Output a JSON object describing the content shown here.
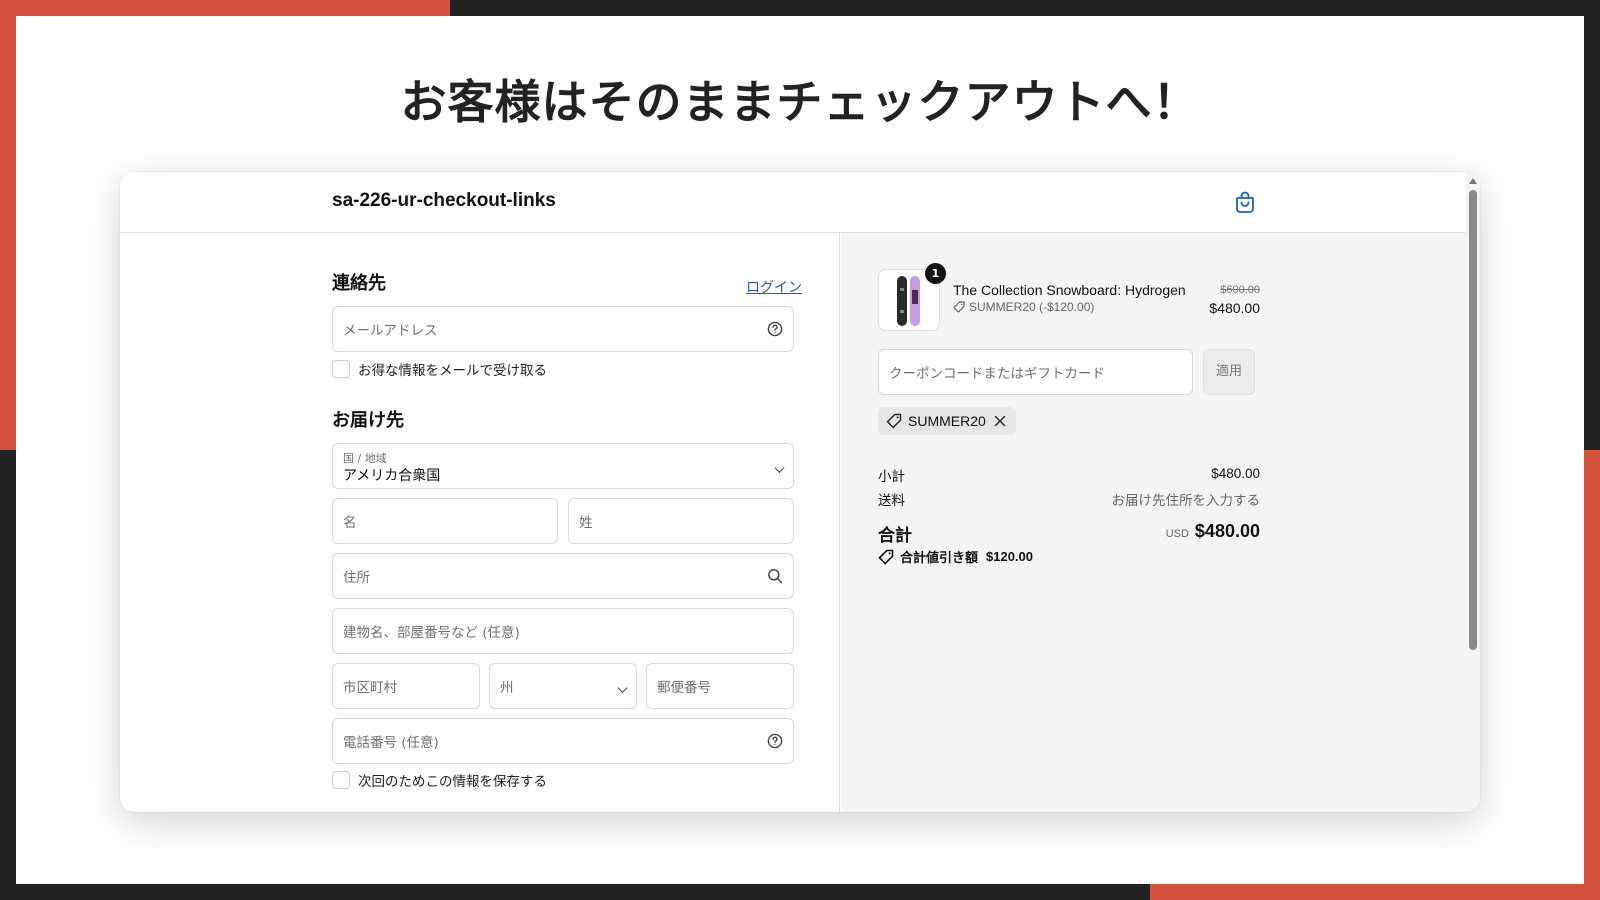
{
  "slide": {
    "headline": "お客様はそのままチェックアウトへ！"
  },
  "colors": {
    "accent_band": "#d4523d",
    "frame": "#222222",
    "link": "#1a5fb4",
    "order_summary_bg": "#f5f5f5"
  },
  "store": {
    "name": "sa-226-ur-checkout-links",
    "cart_icon": "shopping-bag-icon"
  },
  "contact": {
    "title": "連絡先",
    "login_label": "ログイン",
    "email_placeholder": "メールアドレス",
    "newsletter_label": "お得な情報をメールで受け取る"
  },
  "delivery": {
    "title": "お届け先",
    "country_label": "国 / 地域",
    "country_value": "アメリカ合衆国",
    "first_name_placeholder": "名",
    "last_name_placeholder": "姓",
    "address_placeholder": "住所",
    "apartment_placeholder": "建物名、部屋番号など (任意)",
    "city_placeholder": "市区町村",
    "state_placeholder": "州",
    "zip_placeholder": "郵便番号",
    "phone_placeholder": "電話番号 (任意)",
    "save_info_label": "次回のためこの情報を保存する"
  },
  "order_summary": {
    "item": {
      "name": "The Collection Snowboard: Hydrogen",
      "discount": "SUMMER20 (-$120.00)",
      "original_price": "$600.00",
      "price": "$480.00",
      "quantity": "1"
    },
    "coupon_placeholder": "クーポンコードまたはギフトカード",
    "apply_label": "適用",
    "applied_code": "SUMMER20",
    "subtotal_label": "小計",
    "subtotal_value": "$480.00",
    "shipping_label": "送料",
    "shipping_value": "お届け先住所を入力する",
    "total_label": "合計",
    "currency": "USD",
    "total_value": "$480.00",
    "savings_label": "合計値引き額",
    "savings_value": "$120.00"
  }
}
